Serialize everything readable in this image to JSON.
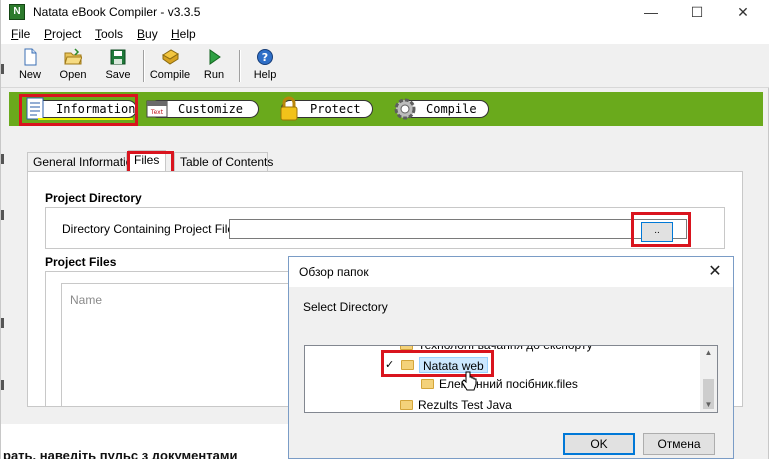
{
  "window": {
    "title": "Natata eBook Compiler - v3.3.5",
    "app_icon_glyph": "N",
    "controls": {
      "minimize": "—",
      "maximize": "☐",
      "close": "✕"
    }
  },
  "menu": [
    {
      "label": "File",
      "accel": "F",
      "rest": "ile"
    },
    {
      "label": "Project",
      "accel": "P",
      "rest": "roject"
    },
    {
      "label": "Tools",
      "accel": "T",
      "rest": "ools"
    },
    {
      "label": "Buy",
      "accel": "B",
      "rest": "uy"
    },
    {
      "label": "Help",
      "accel": "H",
      "rest": "elp"
    }
  ],
  "toolbar": {
    "new": "New",
    "open": "Open",
    "save": "Save",
    "compile": "Compile",
    "run": "Run",
    "help": "Help"
  },
  "nav": {
    "information": "Information",
    "customize": "Customize",
    "protect": "Protect",
    "compile": "Compile",
    "customize_icon_text": "Text"
  },
  "tabs": {
    "general": "General Information",
    "files": "Files",
    "toc": "Table of Contents"
  },
  "project_directory": {
    "title": "Project Directory",
    "label": "Directory Containing Project Files:",
    "value": "",
    "browse_label": ".."
  },
  "project_files": {
    "title": "Project Files",
    "column_name": "Name"
  },
  "background_text": "рать, наведіть пульс з документами",
  "dialog": {
    "title": "Обзор папок",
    "label": "Select Directory",
    "tree": {
      "item_top": "Технології вачання до експорту",
      "item_selected": "Natata web",
      "item_child": "Елек    онний посібник.files",
      "item_bottom": "Rezults Test Java"
    },
    "ok": "OK",
    "cancel": "Отмена"
  },
  "colors": {
    "accent_green": "#6aaa1c",
    "highlight_red": "#d9141e",
    "selection": "#cce8ff",
    "focus_blue": "#0078d7"
  }
}
